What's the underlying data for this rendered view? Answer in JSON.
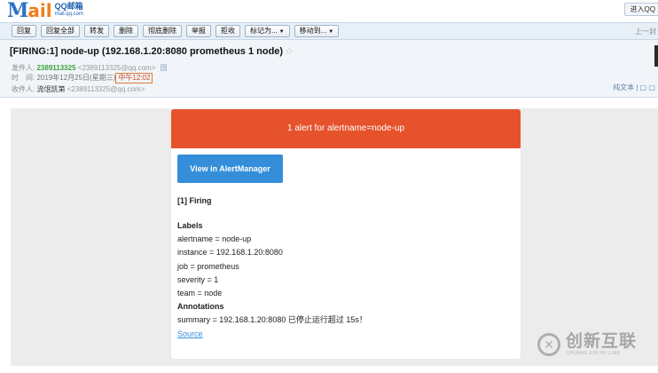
{
  "header": {
    "logo_main": "M",
    "logo_rest": "ail",
    "logo_sub1": "QQ邮箱",
    "logo_sub2": "mail.qq.com",
    "enter_label": "进入QQ"
  },
  "toolbar": {
    "buttons": [
      "回复",
      "回复全部",
      "转发",
      "删除",
      "彻底删除",
      "举报",
      "拒收",
      "标记为...",
      "移动到..."
    ],
    "prev_label": "上一封"
  },
  "mail": {
    "subject": "[FIRING:1] node-up (192.168.1.20:8080 prometheus 1 node)",
    "star": "☆",
    "from_label": "发件人:",
    "from_name": "2389113325",
    "from_addr": "<2389113325@qq.com>",
    "from_badge": "圆",
    "time_label": "时　间:",
    "time_date": "2019年12月25日(星期三)",
    "time_clock": "中午12:02",
    "to_label": "收件人:",
    "to_name": "流氓凯第",
    "to_addr": "<2389113325@qq.com>",
    "plain_text": "纯文本 | ▢ ▢"
  },
  "alert": {
    "banner": "1 alert for alertname=node-up",
    "button": "View in AlertManager",
    "firing": "[1] Firing",
    "labels_heading": "Labels",
    "labels": [
      "alertname = node-up",
      "instance = 192.168.1.20:8080",
      "job = prometheus",
      "severity = 1",
      "team = node"
    ],
    "annotations_heading": "Annotations",
    "summary": "summary = 192.168.1.20:8080 已停止运行超过 15s！",
    "source_link": "Source"
  },
  "watermark": {
    "cn": "创新互联",
    "en": "CHUANG XIN HU LIAN",
    "icon": "✕"
  },
  "colors": {
    "banner": "#e6522c",
    "button": "#348eda",
    "sender": "#3aa33a",
    "time_box": "#e07a3c"
  }
}
